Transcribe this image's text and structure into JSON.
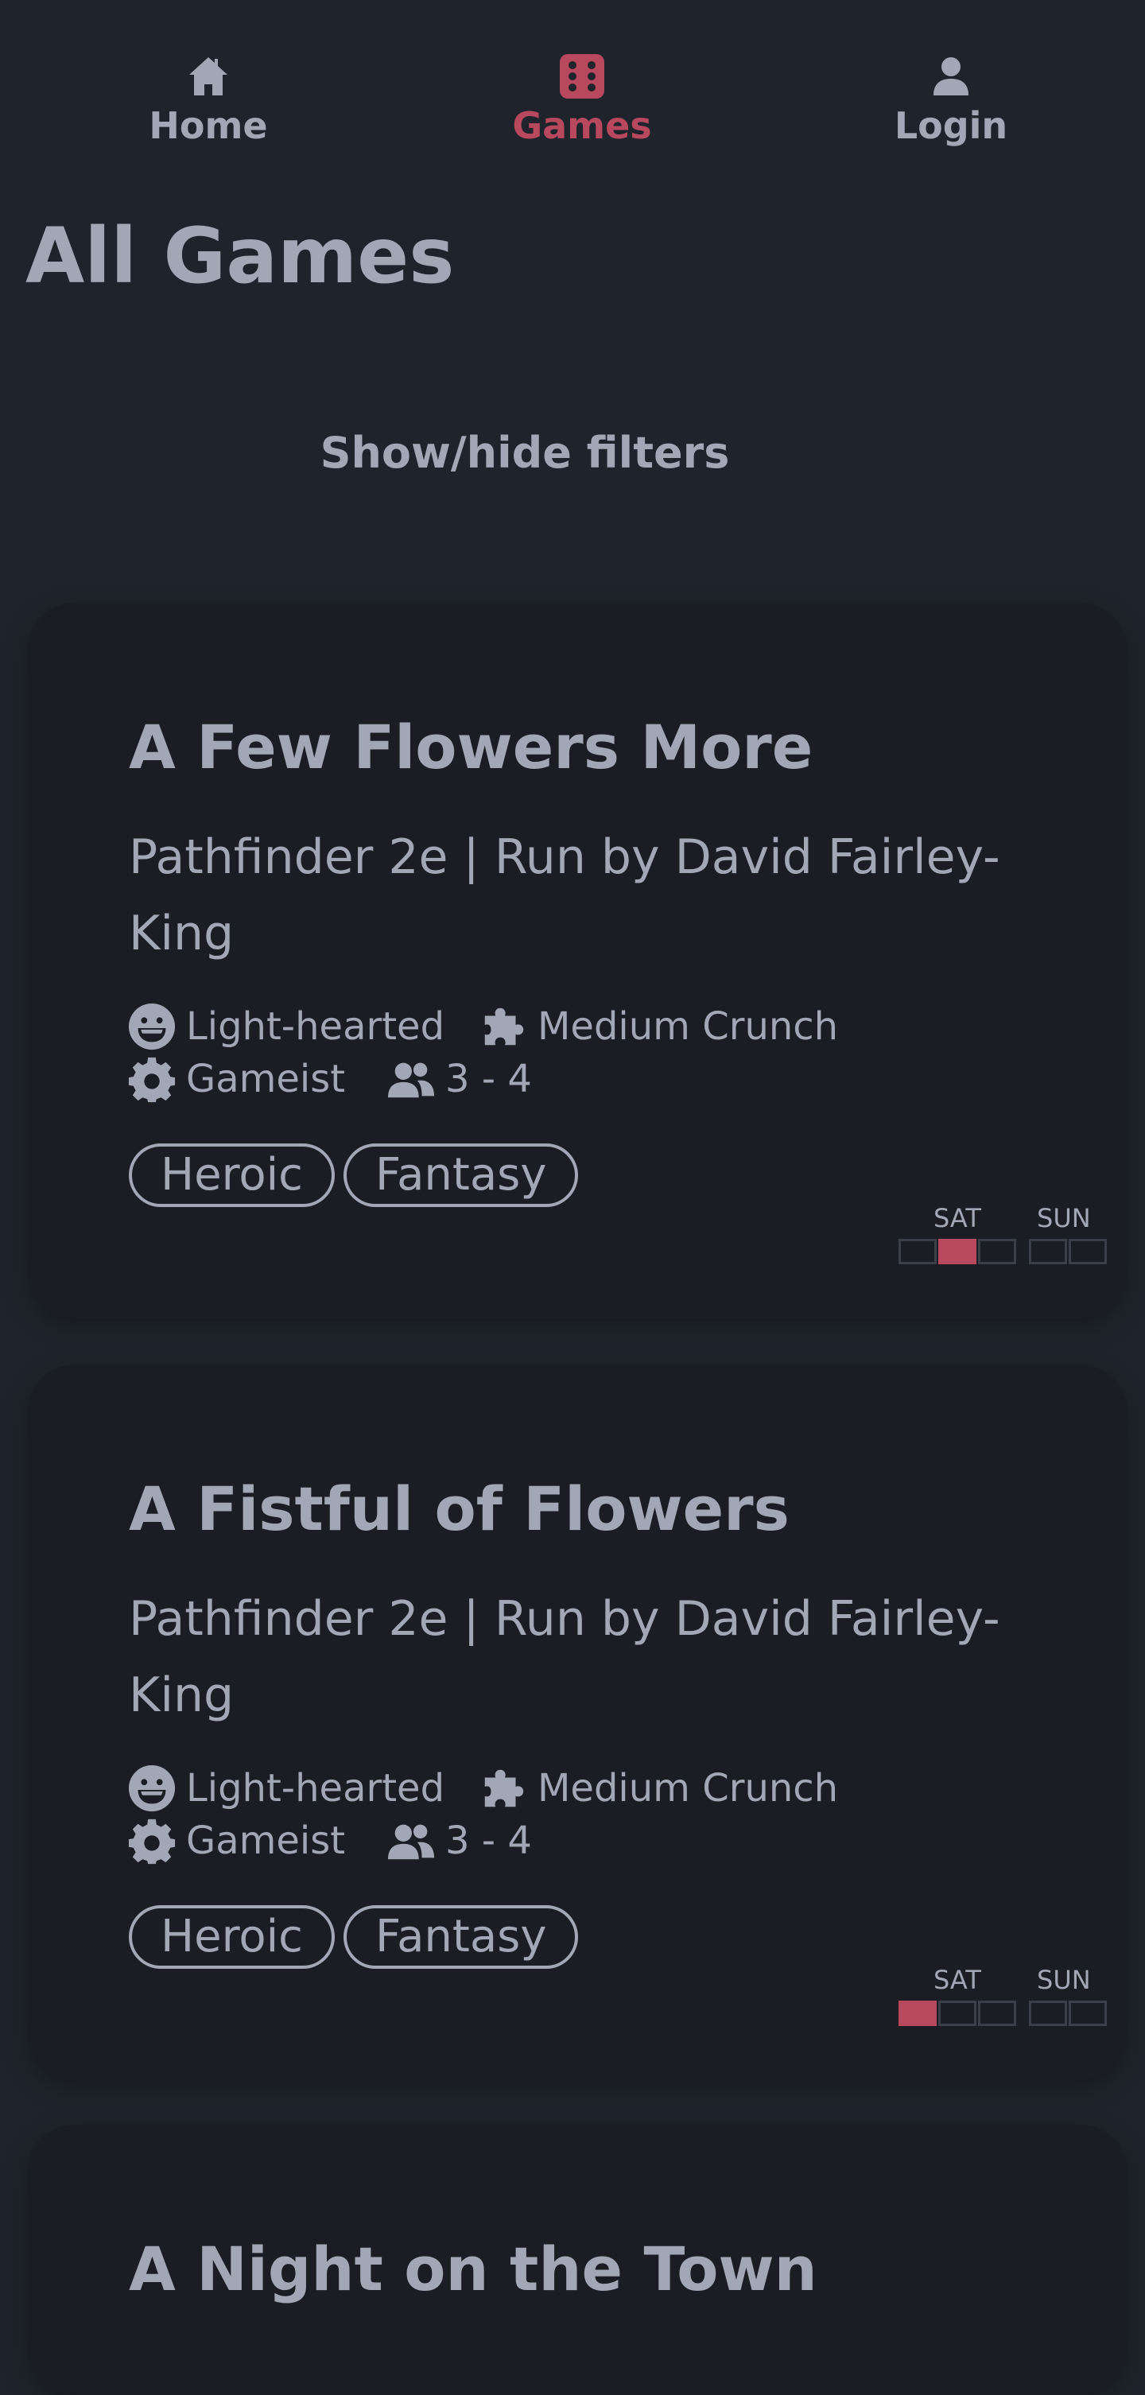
{
  "nav": {
    "home": "Home",
    "games": "Games",
    "login": "Login"
  },
  "page_title": "All Games",
  "filters_toggle": "Show/hide filters",
  "colors": {
    "background": "#1f232b",
    "card": "#1a1d23",
    "text": "#a2a7b5",
    "accent": "#b8485e"
  },
  "games": [
    {
      "title": "A Few Flowers More",
      "subtitle": "Pathfinder 2e | Run by David Fairley-King",
      "tone": "Light-hearted",
      "crunch": "Medium Crunch",
      "style": "Gameist",
      "players": "3 - 4",
      "tags": [
        "Heroic",
        "Fantasy"
      ],
      "schedule": {
        "sat_label": "SAT",
        "sun_label": "SUN",
        "sat_slots": [
          false,
          true,
          false
        ],
        "sun_slots": [
          false,
          false
        ]
      }
    },
    {
      "title": "A Fistful of Flowers",
      "subtitle": "Pathfinder 2e | Run by David Fairley-King",
      "tone": "Light-hearted",
      "crunch": "Medium Crunch",
      "style": "Gameist",
      "players": "3 - 4",
      "tags": [
        "Heroic",
        "Fantasy"
      ],
      "schedule": {
        "sat_label": "SAT",
        "sun_label": "SUN",
        "sat_slots": [
          true,
          false,
          false
        ],
        "sun_slots": [
          false,
          false
        ]
      }
    },
    {
      "title": "A Night on the Town"
    }
  ],
  "icons": {
    "home": "home-icon",
    "games": "dice-icon",
    "login": "user-icon",
    "tone": "laugh-icon",
    "crunch": "puzzle-icon",
    "style": "gear-icon",
    "players": "users-icon"
  }
}
